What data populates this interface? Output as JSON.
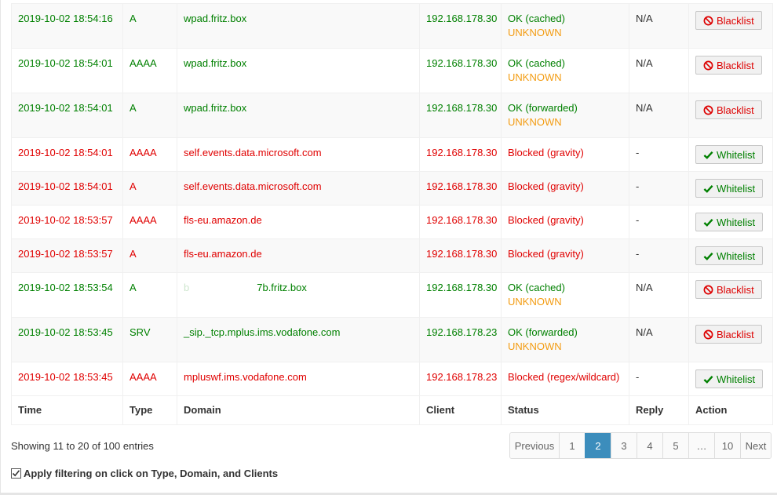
{
  "rows": [
    {
      "time": "2019-10-02 18:54:16",
      "type": "A",
      "domain": "wpad.fritz.box",
      "client": "192.168.178.30",
      "status": "OK (cached)",
      "substatus": "UNKNOWN",
      "reply": "N/A",
      "action": "Blacklist"
    },
    {
      "time": "2019-10-02 18:54:01",
      "type": "AAAA",
      "domain": "wpad.fritz.box",
      "client": "192.168.178.30",
      "status": "OK (cached)",
      "substatus": "UNKNOWN",
      "reply": "N/A",
      "action": "Blacklist"
    },
    {
      "time": "2019-10-02 18:54:01",
      "type": "A",
      "domain": "wpad.fritz.box",
      "client": "192.168.178.30",
      "status": "OK (forwarded)",
      "substatus": "UNKNOWN",
      "reply": "N/A",
      "action": "Blacklist"
    },
    {
      "time": "2019-10-02 18:54:01",
      "type": "AAAA",
      "domain": "self.events.data.microsoft.com",
      "client": "192.168.178.30",
      "status": "Blocked (gravity)",
      "reply": "-",
      "action": "Whitelist"
    },
    {
      "time": "2019-10-02 18:54:01",
      "type": "A",
      "domain": "self.events.data.microsoft.com",
      "client": "192.168.178.30",
      "status": "Blocked (gravity)",
      "reply": "-",
      "action": "Whitelist"
    },
    {
      "time": "2019-10-02 18:53:57",
      "type": "AAAA",
      "domain": "fls-eu.amazon.de",
      "client": "192.168.178.30",
      "status": "Blocked (gravity)",
      "reply": "-",
      "action": "Whitelist"
    },
    {
      "time": "2019-10-02 18:53:57",
      "type": "A",
      "domain": "fls-eu.amazon.de",
      "client": "192.168.178.30",
      "status": "Blocked (gravity)",
      "reply": "-",
      "action": "Whitelist"
    },
    {
      "time": "2019-10-02 18:53:54",
      "type": "A",
      "domain_prefix": "b",
      "domain": "7b.fritz.box",
      "client": "192.168.178.30",
      "status": "OK (cached)",
      "substatus": "UNKNOWN",
      "reply": "N/A",
      "action": "Blacklist"
    },
    {
      "time": "2019-10-02 18:53:45",
      "type": "SRV",
      "domain": "_sip._tcp.mplus.ims.vodafone.com",
      "client": "192.168.178.23",
      "status": "OK (forwarded)",
      "substatus": "UNKNOWN",
      "reply": "N/A",
      "action": "Blacklist"
    },
    {
      "time": "2019-10-02 18:53:45",
      "type": "AAAA",
      "domain": "mpluswf.ims.vodafone.com",
      "client": "192.168.178.23",
      "status": "Blocked (regex/wildcard)",
      "reply": "-",
      "action": "Whitelist"
    }
  ],
  "columns": {
    "time": "Time",
    "type": "Type",
    "domain": "Domain",
    "client": "Client",
    "status": "Status",
    "reply": "Reply",
    "action": "Action"
  },
  "info": "Showing 11 to 20 of 100 entries",
  "pagination": {
    "previous": "Previous",
    "pages": [
      "1",
      "2",
      "3",
      "4",
      "5",
      "…",
      "10"
    ],
    "next": "Next",
    "active_page": "2"
  },
  "filter_label": "Apply filtering on click on Type, Domain, and Clients",
  "colors": {
    "ok": "#008000",
    "blocked": "#e00000",
    "unknown": "#f39c12",
    "active_page": "#3c8dbc"
  }
}
